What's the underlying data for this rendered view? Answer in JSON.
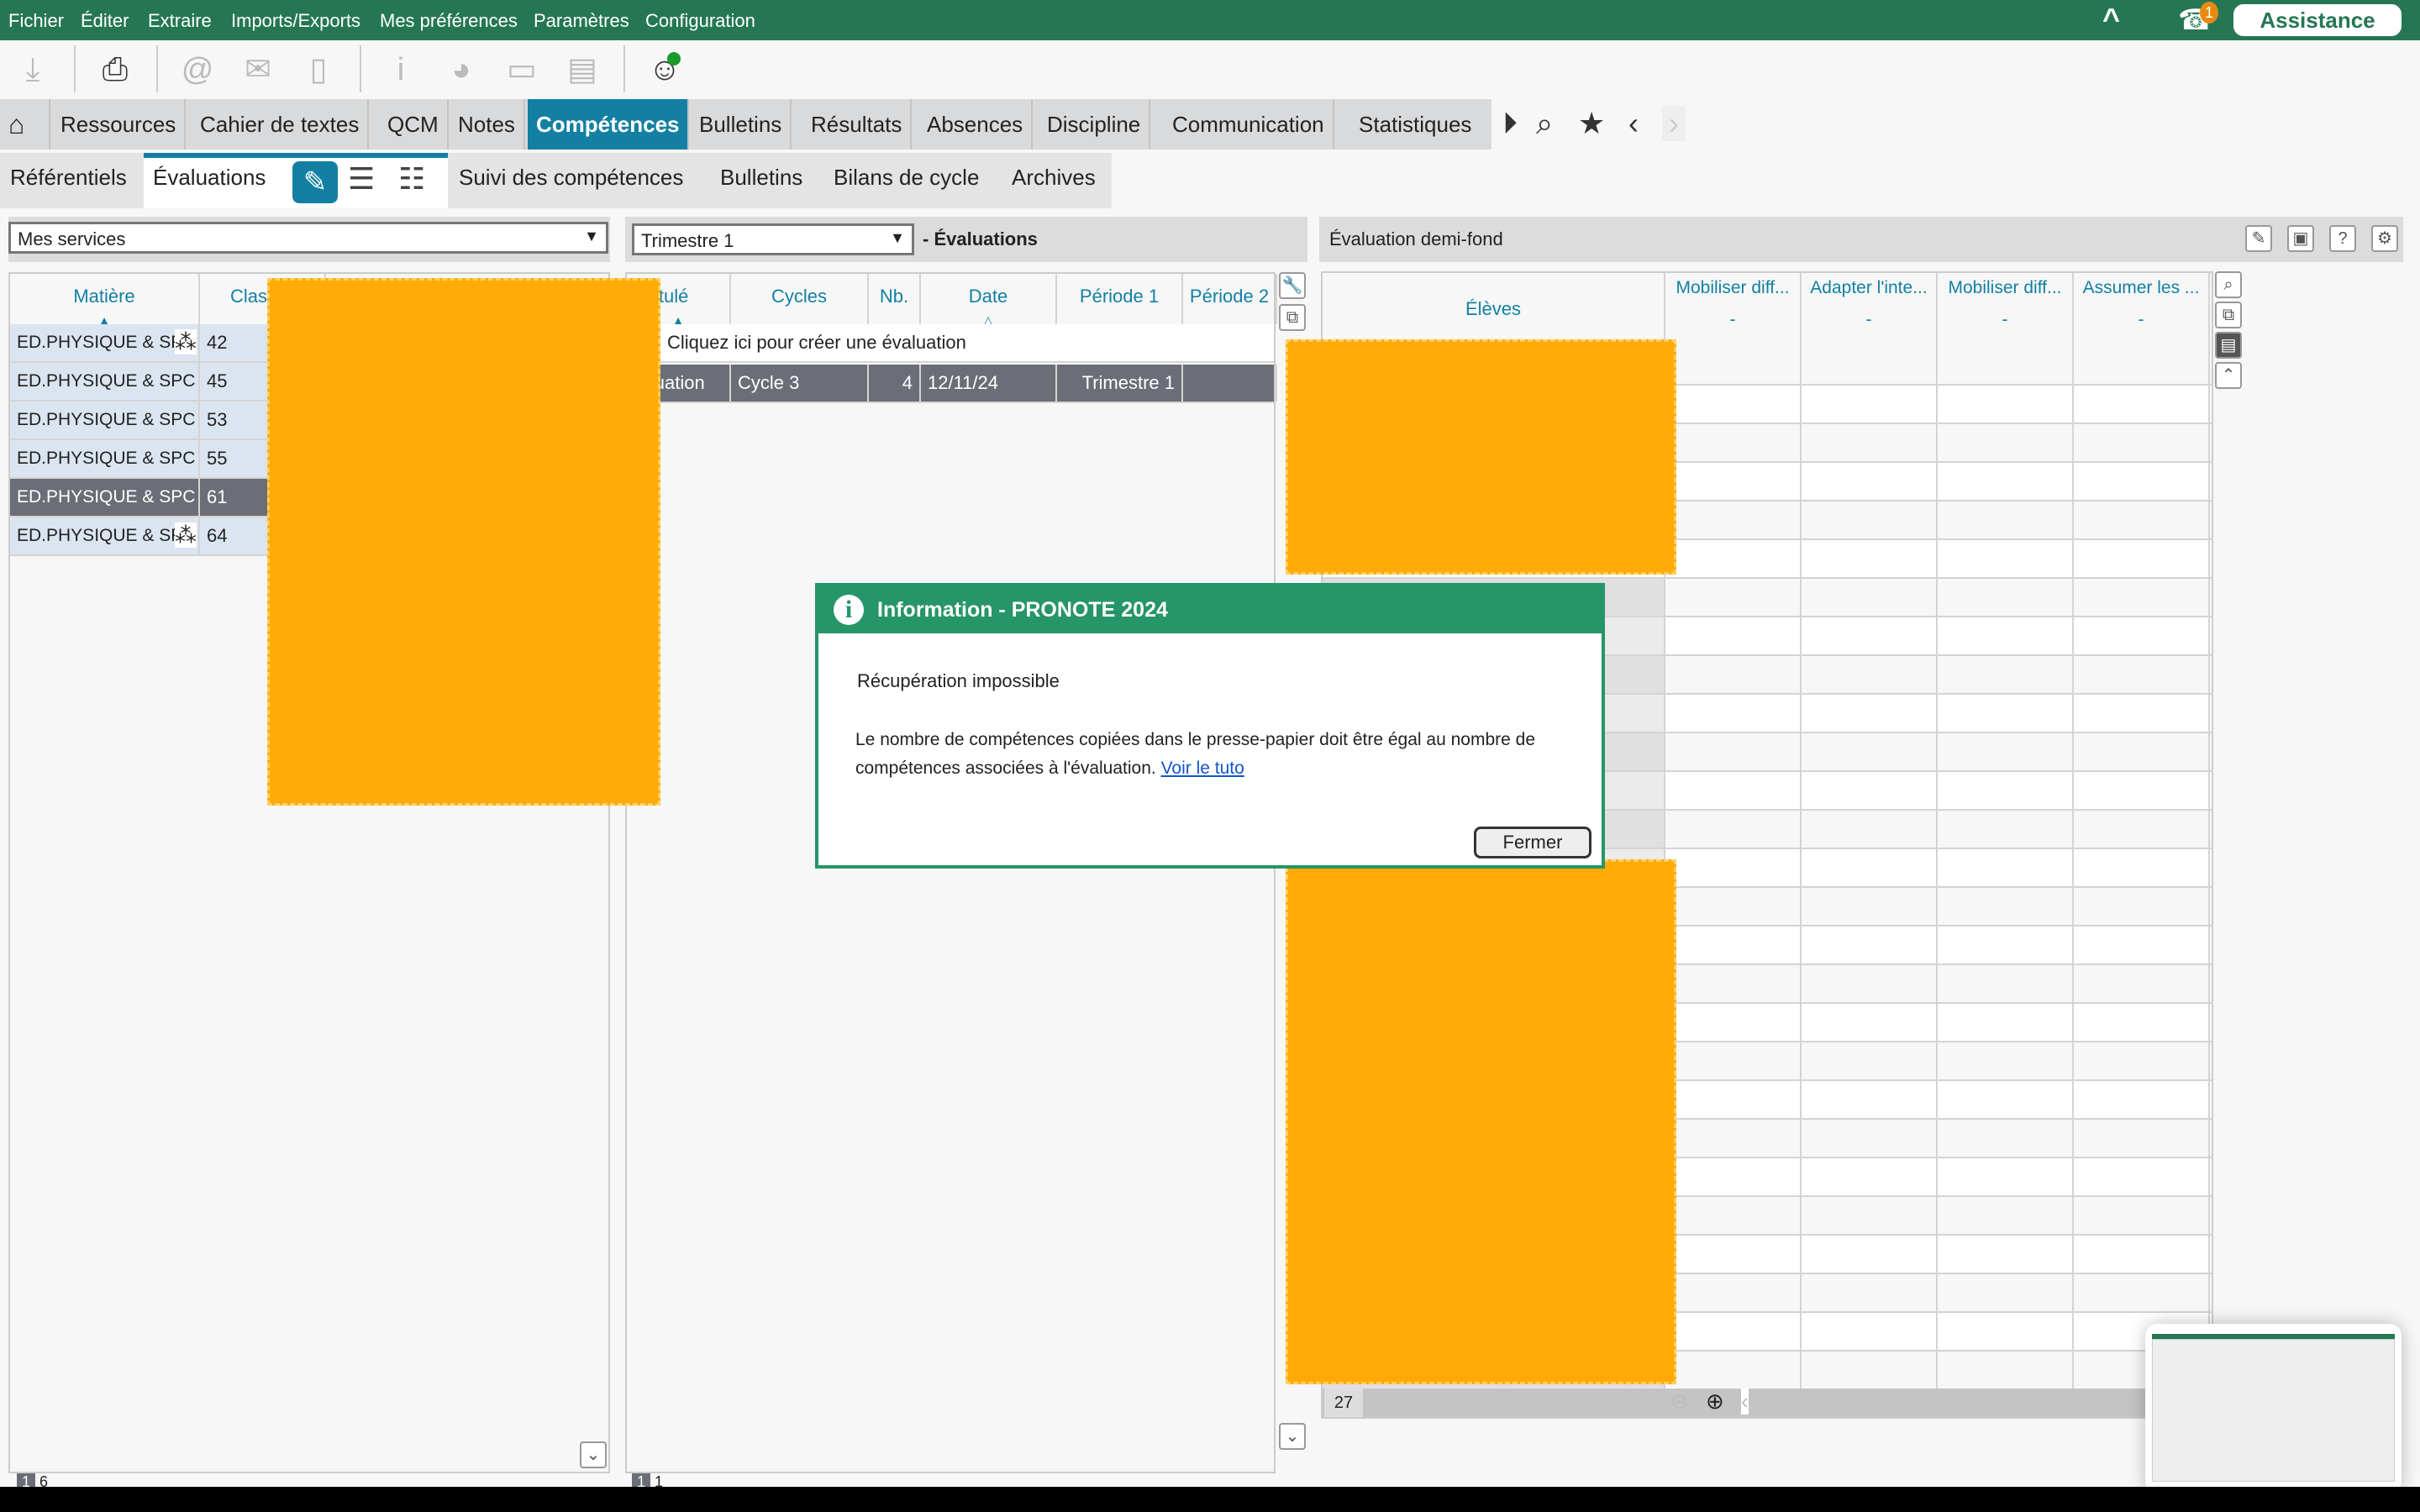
{
  "menu": {
    "items": [
      "Fichier",
      "Éditer",
      "Extraire",
      "Imports/Exports",
      "Mes préférences",
      "Paramètres",
      "Configuration"
    ],
    "notif_count": "1",
    "assistance": "Assistance"
  },
  "toolbar": {
    "icons": [
      "download-icon",
      "print-icon",
      "email-icon",
      "letter-icon",
      "mobile-icon",
      "info-icon",
      "pie-chart-icon",
      "chat-icon",
      "calculator-icon",
      "support-chat-icon"
    ]
  },
  "tabs": {
    "items": [
      "Ressources",
      "Cahier de textes",
      "QCM",
      "Notes",
      "Compétences",
      "Bulletins",
      "Résultats",
      "Absences",
      "Discipline",
      "Communication",
      "Statistiques"
    ],
    "active": "Compétences"
  },
  "subtabs": {
    "items": [
      "Référentiels",
      "Évaluations",
      "Suivi des compétences",
      "Bulletins",
      "Bilans de cycle",
      "Archives"
    ],
    "active": "Évaluations"
  },
  "left": {
    "select": "Mes services",
    "headers": [
      "Matière",
      "Class"
    ],
    "rows": [
      {
        "matiere": "ED.PHYSIQUE & SPC",
        "classe": "42",
        "group": true
      },
      {
        "matiere": "ED.PHYSIQUE & SPC",
        "classe": "45",
        "group": false
      },
      {
        "matiere": "ED.PHYSIQUE & SPC",
        "classe": "53",
        "group": false
      },
      {
        "matiere": "ED.PHYSIQUE & SPC",
        "classe": "55",
        "group": false
      },
      {
        "matiere": "ED.PHYSIQUE & SPC",
        "classe": "61",
        "group": false,
        "selected": true
      },
      {
        "matiere": "ED.PHYSIQUE & SPC",
        "classe": "64",
        "group": true
      }
    ],
    "footer": [
      "1",
      "6"
    ]
  },
  "middle": {
    "select": "Trimestre 1",
    "title": "- Évaluations",
    "headers": [
      "Intitulé",
      "Cycles",
      "Nb.",
      "Date",
      "Période 1",
      "Période 2"
    ],
    "create": "Cliquez ici pour créer une évaluation",
    "rows": [
      {
        "intitule": "Évaluation",
        "cycle": "Cycle 3",
        "nb": "4",
        "date": "12/11/24",
        "periode": "Trimestre 1"
      }
    ],
    "footer": [
      "1",
      "1"
    ]
  },
  "right": {
    "title": "Évaluation demi-fond",
    "eleves": "Élèves",
    "columns": [
      "Mobiliser diff...",
      "Adapter l'inte...",
      "Mobiliser diff...",
      "Assumer les ..."
    ],
    "col_sub": "-",
    "count": "27"
  },
  "dialog": {
    "title": "Information - PRONOTE 2024",
    "heading": "Récupération impossible",
    "message": "Le nombre de compétences copiées dans le presse-papier doit être égal au nombre de compétences associées à l'évaluation.",
    "link": "Voir le tuto",
    "button": "Fermer"
  },
  "colors": {
    "brand": "#257754",
    "accent": "#1380a3",
    "dialog": "#27956a",
    "redaction": "#ffaa07",
    "selected_row": "#6b6e76"
  }
}
